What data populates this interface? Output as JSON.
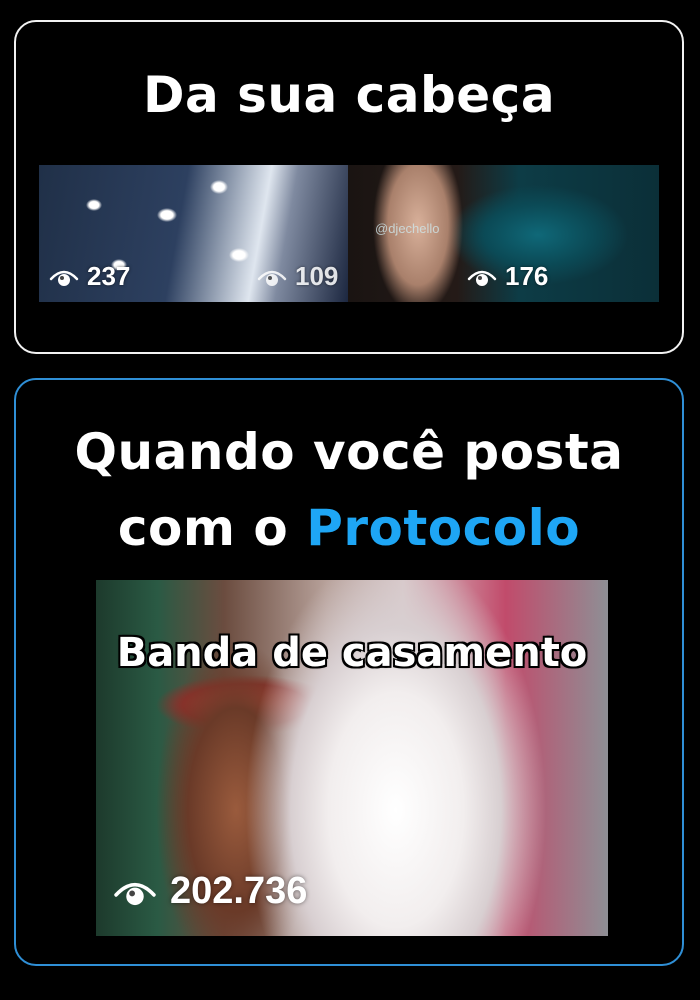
{
  "top_card": {
    "title": "Da sua cabeça",
    "watermark": "@djechello",
    "views": [
      "237",
      "109",
      "176"
    ]
  },
  "bottom_card": {
    "title_line1": "Quando você posta",
    "title_line2_prefix": "com o ",
    "title_line2_accent": "Protocolo",
    "photo_caption": "Banda de casamento",
    "views": "202.736"
  },
  "colors": {
    "accent": "#1ea6f5",
    "top_border": "#f2f2f2",
    "bottom_border": "#2f8fd6",
    "background": "#000000"
  },
  "icons": [
    "eye-icon"
  ]
}
